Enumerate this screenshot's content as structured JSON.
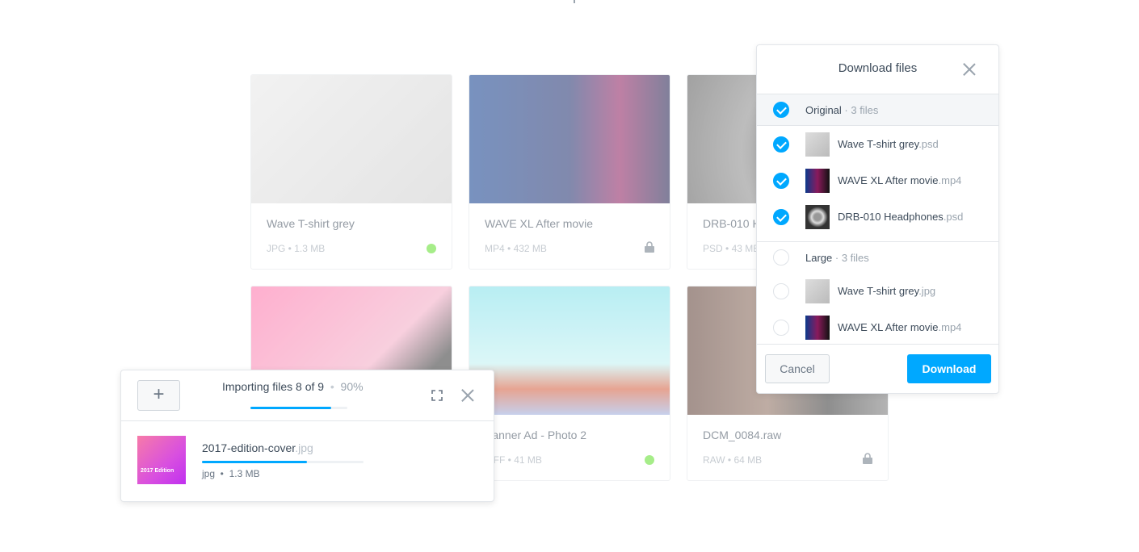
{
  "colors": {
    "accent": "#00a8ff",
    "status_online": "#5fe02a"
  },
  "cards": [
    {
      "title": "Wave T-shirt grey",
      "type": "JPG",
      "size": "1.3 MB",
      "status": "green-dot"
    },
    {
      "title": "WAVE XL After movie",
      "type": "MP4",
      "size": "432 MB",
      "status": "lock-icon"
    },
    {
      "title": "DRB-010 Headphones",
      "type": "PSD",
      "size": "43 MB",
      "status": ""
    },
    {
      "title": "",
      "type": "",
      "size": "",
      "status": ""
    },
    {
      "title": "Banner Ad - Photo 2",
      "type": "TIFF",
      "size": "41 MB",
      "status": "green-dot"
    },
    {
      "title": "DCM_0084.raw",
      "type": "RAW",
      "size": "64 MB",
      "status": "lock-icon"
    }
  ],
  "dialog": {
    "title": "Download files",
    "groups": [
      {
        "label": "Original",
        "count": "· 3 files",
        "checked": true,
        "files": [
          {
            "name": "Wave T-shirt grey",
            "ext": ".psd",
            "checked": true
          },
          {
            "name": "WAVE XL After movie",
            "ext": ".mp4",
            "checked": true
          },
          {
            "name": "DRB-010 Headphones",
            "ext": ".psd",
            "checked": true
          }
        ]
      },
      {
        "label": "Large",
        "count": "· 3 files",
        "checked": false,
        "files": [
          {
            "name": "Wave T-shirt grey",
            "ext": ".jpg",
            "checked": false
          },
          {
            "name": "WAVE XL After movie",
            "ext": ".mp4",
            "checked": false
          }
        ]
      }
    ],
    "cancel": "Cancel",
    "download": "Download"
  },
  "importer": {
    "title": "Importing files 8 of 9",
    "percent": "90%",
    "progress": 0.9,
    "file": {
      "name": "2017-edition-cover",
      "ext": ".jpg",
      "type": "jpg",
      "size": "1.3 MB",
      "progress": 0.65,
      "thumb_text": "2017 Edition"
    }
  }
}
